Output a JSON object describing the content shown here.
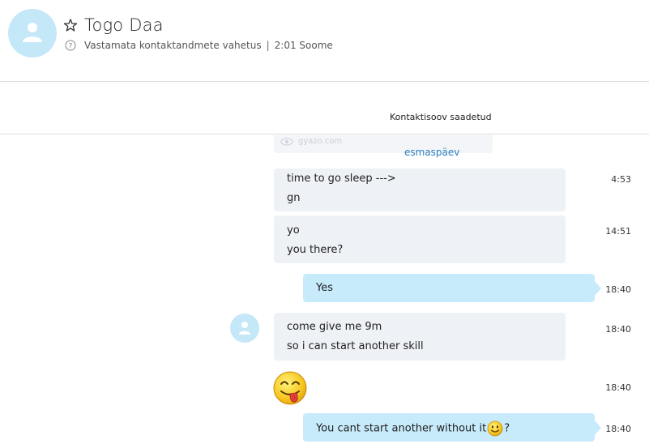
{
  "contact": {
    "name": "Togo Daa",
    "status": "Vastamata kontaktandmete vahetus",
    "separator": "|",
    "local_time": "2:01 Soome"
  },
  "request_bar": {
    "text": "Kontaktisoov saadetud"
  },
  "faded_preview": {
    "text": "gyazo.com"
  },
  "day_separator": "esmaspäev",
  "messages": [
    {
      "direction": "in",
      "lines": [
        "time to go sleep --->",
        "gn"
      ],
      "time": "4:53"
    },
    {
      "direction": "in",
      "lines": [
        "yo",
        "you there?"
      ],
      "time": "14:51"
    },
    {
      "direction": "out",
      "lines": [
        "Yes"
      ],
      "time": "18:40"
    },
    {
      "direction": "in",
      "lines": [
        "come give me 9m",
        "so i can start another skill"
      ],
      "time": "18:40"
    },
    {
      "direction": "in",
      "emoji": "tongue-out-emoji",
      "time": "18:40"
    },
    {
      "direction": "out",
      "text_before": "You cant start another without it",
      "emoji": "smile-emoji",
      "text_after": "?",
      "time": "18:40"
    }
  ],
  "colors": {
    "avatar_bg": "#c4e8f8",
    "incoming_bubble": "#eef1f5",
    "outgoing_bubble": "#c7ebfb",
    "day_separator": "#2a7fbf"
  }
}
